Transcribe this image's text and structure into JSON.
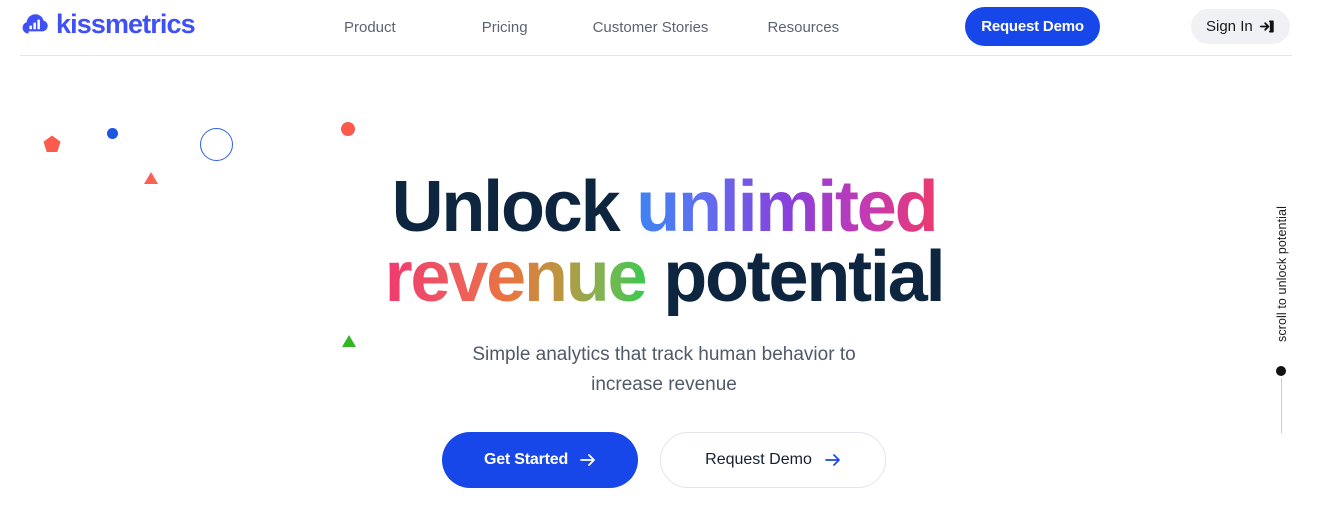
{
  "brand": {
    "name": "kissmetrics",
    "logo_icon": "cloud-bar-chart-icon",
    "color": "#3f51f5"
  },
  "header": {
    "nav": [
      {
        "label": "Product",
        "icon": "nav-link"
      },
      {
        "label": "Pricing",
        "icon": "nav-link"
      },
      {
        "label": "Customer Stories",
        "icon": "nav-link"
      },
      {
        "label": "Resources",
        "icon": "nav-link"
      }
    ],
    "request_demo_label": "Request Demo",
    "sign_in_label": "Sign In",
    "sign_in_icon": "sign-in-arrow-icon",
    "primary_color": "#1747e8",
    "signin_bg": "#f0f1f4"
  },
  "hero": {
    "headline": {
      "line1_word1": "Unlock",
      "line1_word2": "unlimited",
      "line2_word1": "revenue",
      "line2_word2": "potential"
    },
    "subtitle_line1": "Simple analytics that track human behavior to",
    "subtitle_line2": "increase revenue",
    "cta_primary": "Get Started",
    "cta_primary_icon": "arrow-right-icon",
    "cta_secondary": "Request Demo",
    "cta_secondary_icon": "arrow-right-icon",
    "colors": {
      "dark_text": "#0d253f",
      "gradient_unlimited_start": "#3d84f5",
      "gradient_unlimited_mid": "#8b3fd9",
      "gradient_unlimited_end": "#ec3a6e",
      "gradient_revenue_start": "#ef3a70",
      "gradient_revenue_mid": "#e8763f",
      "gradient_revenue_end": "#3cc94e"
    }
  },
  "decor": {
    "shapes": [
      {
        "name": "pentagon-red",
        "color": "#fb5b4d"
      },
      {
        "name": "dot-blue",
        "color": "#1b55e0"
      },
      {
        "name": "triangle-red",
        "color": "#fc6254"
      },
      {
        "name": "circle-outline-blue",
        "color": "#2f62e8"
      },
      {
        "name": "dot-red",
        "color": "#fc5a4c"
      },
      {
        "name": "triangle-green",
        "color": "#34b622"
      }
    ]
  },
  "scroll_indicator": {
    "label": "scroll to unlock potential",
    "dot_color": "#111111",
    "line_color": "#c9ccd1"
  }
}
